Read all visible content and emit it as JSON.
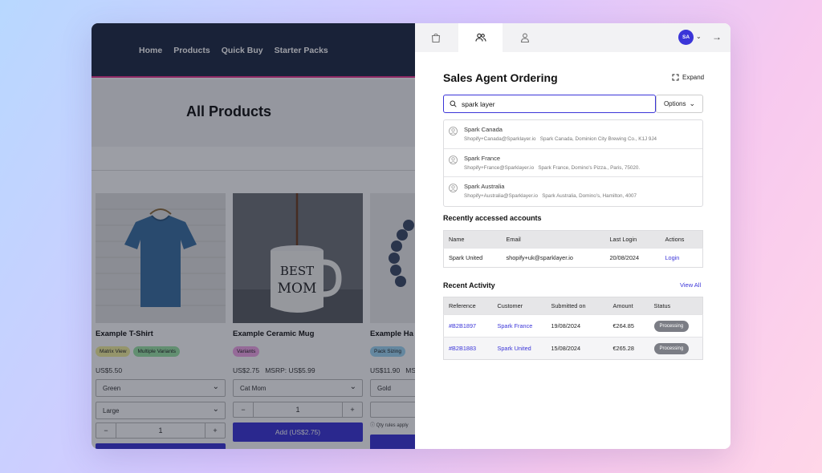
{
  "store": {
    "nav": [
      "Home",
      "Products",
      "Quick Buy",
      "Starter Packs"
    ],
    "page_title": "All Products",
    "products": [
      {
        "name": "Example T-Shirt",
        "tags": [
          {
            "label": "Matrix View",
            "color": "#f3ef9c"
          },
          {
            "label": "Multiple Variants",
            "color": "#9be6a6"
          }
        ],
        "price": "US$5.50",
        "selects": [
          "Green",
          "Large"
        ],
        "qty": "1",
        "minus": "−",
        "plus": "+"
      },
      {
        "name": "Example Ceramic Mug",
        "tags": [
          {
            "label": "Variants",
            "color": "#f3a6e8"
          }
        ],
        "price": "US$2.75",
        "msrp": "MSRP: US$5.99",
        "selects": [
          "Cat Mom"
        ],
        "qty": "1",
        "minus": "−",
        "plus": "+",
        "add_label": "Add (US$2.75)",
        "mug_text": "BEST\nMOM"
      },
      {
        "name": "Example Ha",
        "tags": [
          {
            "label": "Pack Sizing",
            "color": "#9fd8f5"
          }
        ],
        "price": "US$11.90",
        "msrp": "MS",
        "selects": [
          "Gold"
        ],
        "note": "ⓘ Qty rules apply",
        "add_label": "A"
      }
    ]
  },
  "panel": {
    "tabs": [
      "shopping-bag-icon",
      "users-icon",
      "user-icon"
    ],
    "avatar_initials": "SA",
    "title": "Sales Agent Ordering",
    "expand_label": "Expand",
    "search": {
      "value": "spark layer",
      "placeholder": ""
    },
    "options_label": "Options",
    "results": [
      {
        "name": "Spark Canada",
        "email": "Shopify+Canada@Sparklayer.io",
        "details": "Spark Canada, Dominion City Brewing Co., K1J 9J4"
      },
      {
        "name": "Spark France",
        "email": "Shopify+France@Sparklayer.io",
        "details": "Spark France, Domino's Pizza., Paris, 75020."
      },
      {
        "name": "Spark Australia",
        "email": "Shopify+Australia@Sparklayer.io",
        "details": "Spark Australia, Domino's, Hamilton, 4007"
      }
    ],
    "recent_accounts": {
      "title": "Recently accessed accounts",
      "headers": [
        "Name",
        "Email",
        "Last Login",
        "Actions"
      ],
      "rows": [
        {
          "name": "Spark United",
          "email": "shopify+uk@sparklayer.io",
          "last_login": "20/08/2024",
          "action": "Login"
        }
      ]
    },
    "recent_activity": {
      "title": "Recent Activity",
      "view_all": "View All",
      "headers": [
        "Reference",
        "Customer",
        "Submitted on",
        "Amount",
        "Status"
      ],
      "rows": [
        {
          "ref": "#B2B1897",
          "customer": "Spark France",
          "submitted": "19/08/2024",
          "amount": "€264.85",
          "status": "Processing"
        },
        {
          "ref": "#B2B1883",
          "customer": "Spark United",
          "submitted": "15/08/2024",
          "amount": "€265.28",
          "status": "Processing"
        }
      ]
    }
  },
  "colors": {
    "accent": "#3b35d8",
    "nav_bg": "#1e2a44",
    "nav_underline": "#e8368f",
    "status_pill": "#7b7d85"
  }
}
